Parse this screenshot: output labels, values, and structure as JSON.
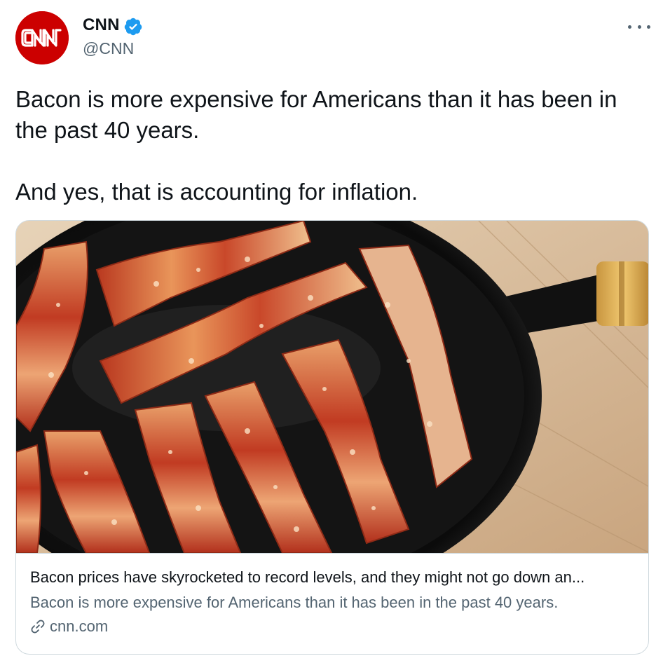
{
  "author": {
    "name": "CNN",
    "handle": "@CNN",
    "avatar_text": "CNN",
    "verified": true,
    "avatar_color": "#cc0000"
  },
  "tweet": {
    "lines": [
      "Bacon is more expensive for Americans than it has been in the past 40 years.",
      "And yes, that is accounting for inflation."
    ]
  },
  "card": {
    "image_icon": "bacon-in-skillet-image",
    "title": "Bacon prices have skyrocketed to record levels, and they might not go down an...",
    "description": "Bacon is more expensive for Americans than it has been in the past 40 years.",
    "domain": "cnn.com"
  },
  "icons": {
    "verified": "verified-badge-icon",
    "more": "more-options-icon",
    "link": "link-icon"
  },
  "colors": {
    "text": "#0f1419",
    "secondary": "#536471",
    "verified": "#1d9bf0",
    "border": "#cfd9de"
  }
}
